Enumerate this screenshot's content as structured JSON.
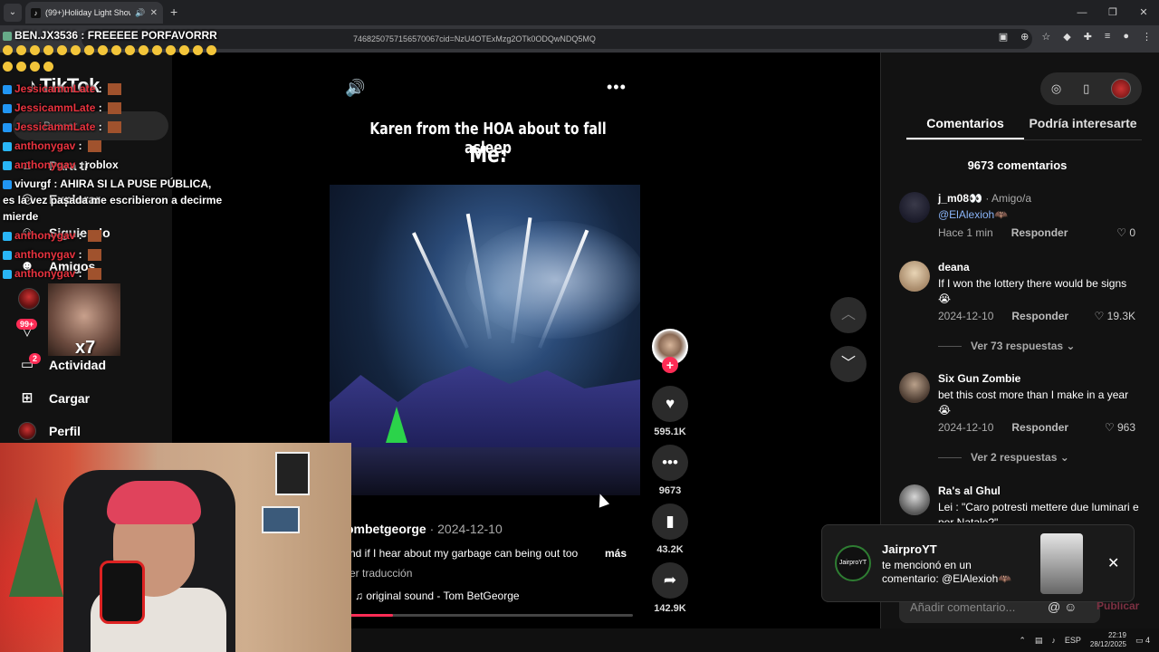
{
  "browser": {
    "tab_title": "(99+)Holiday Light Show w",
    "url": "7468250757156570067cid=NzU4OTExMzg2OTk0ODQwNDQ5MQ"
  },
  "sidebar": {
    "logo": "TikTok",
    "search_label": "Buscar",
    "items": [
      {
        "label": "Para ti",
        "icon": "home-icon"
      },
      {
        "label": "Explorar",
        "icon": "compass-icon"
      },
      {
        "label": "Siguiendo",
        "icon": "following-icon"
      },
      {
        "label": "Amigos",
        "icon": "friends-icon"
      },
      {
        "label": "",
        "icon": "live-icon"
      },
      {
        "label": "",
        "icon": "messages-icon"
      },
      {
        "label": "Actividad",
        "icon": "activity-icon"
      },
      {
        "label": "Cargar",
        "icon": "upload-icon"
      },
      {
        "label": "Perfil",
        "icon": "profile-icon"
      }
    ],
    "badge_messages": "99+",
    "badge_activity": "2"
  },
  "video": {
    "caption_line1": "Karen from the HOA about to fall asleep",
    "caption_line2": "Me:",
    "author": "ombetgeorge",
    "date": "· 2024-12-10",
    "description": "nd if I hear about my garbage can being out too",
    "more_label": "más",
    "translate_label": "er traducción",
    "sound": "original sound - Tom BetGeorge",
    "likes": "595.1K",
    "comments": "9673",
    "saves": "43.2K",
    "shares": "142.9K",
    "progress": 0.15
  },
  "comments_panel": {
    "tab_comments": "Comentarios",
    "tab_interest": "Podría interesarte",
    "count": "9673 comentarios",
    "add_placeholder": "Añadir comentario...",
    "publish_label": "Publicar",
    "items": [
      {
        "user": "j_m08👀",
        "friend": "· Amigo/a",
        "text": "",
        "mention": "@ElAlexioh🦇",
        "meta_time": "Hace 1 min",
        "reply": "Responder",
        "likes": "0"
      },
      {
        "user": "deana",
        "friend": "",
        "text": "If I won the lottery there would be signs 😭",
        "mention": "",
        "meta_time": "2024-12-10",
        "reply": "Responder",
        "likes": "19.3K",
        "replies": "Ver 73 respuestas"
      },
      {
        "user": "Six Gun Zombie",
        "friend": "",
        "text": "bet this cost more than I make in a year 😭",
        "mention": "",
        "meta_time": "2024-12-10",
        "reply": "Responder",
        "likes": "963",
        "replies": "Ver 2 respuestas"
      },
      {
        "user": "Ra's al Ghul",
        "friend": "",
        "text": "Lei : \"Caro potresti mettere due luminari e per Natale?\"",
        "mention": "",
        "meta_time": "",
        "reply": "",
        "likes": ""
      }
    ]
  },
  "toast": {
    "name": "JairproYT",
    "message": "te mencionó en un comentario: @ElAlexioh🦇",
    "avatar_text": "JairproYT"
  },
  "overlay_chat": {
    "top_line": "BEN.JX3536 : FREEEEE PORFAVORRR",
    "lines": [
      {
        "user": "JessicammLate",
        "text": "",
        "color": "#e8333f"
      },
      {
        "user": "JessicammLate",
        "text": "",
        "color": "#e8333f"
      },
      {
        "user": "JessicammLate",
        "text": "",
        "color": "#e8333f"
      },
      {
        "user": "anthonygav",
        "text": "",
        "color": "#e8333f"
      },
      {
        "user": "anthonygav",
        "text": "roblox",
        "color": "#e8333f"
      },
      {
        "user": "vivurgf",
        "text": "AHIRA SI LA PUSE PÚBLICA,",
        "color": "#ffffff"
      },
      {
        "user": "",
        "text": "es la vez pasada me escribieron a decirme",
        "color": "#ffffff"
      },
      {
        "user": "",
        "text": "mierde",
        "color": "#ffffff"
      },
      {
        "user": "anthonygav",
        "text": "",
        "color": "#e8333f"
      },
      {
        "user": "anthonygav",
        "text": "",
        "color": "#e8333f"
      },
      {
        "user": "anthonygav",
        "text": "",
        "color": "#e8333f"
      }
    ],
    "meme_text": "x7"
  },
  "taskbar": {
    "lang": "ESP",
    "time": "22:19",
    "date": "28/12/2025",
    "notif": "4"
  },
  "colors": {
    "accent": "#fe2c55",
    "mention": "#8ab4f8",
    "chat_user": "#e8333f"
  }
}
